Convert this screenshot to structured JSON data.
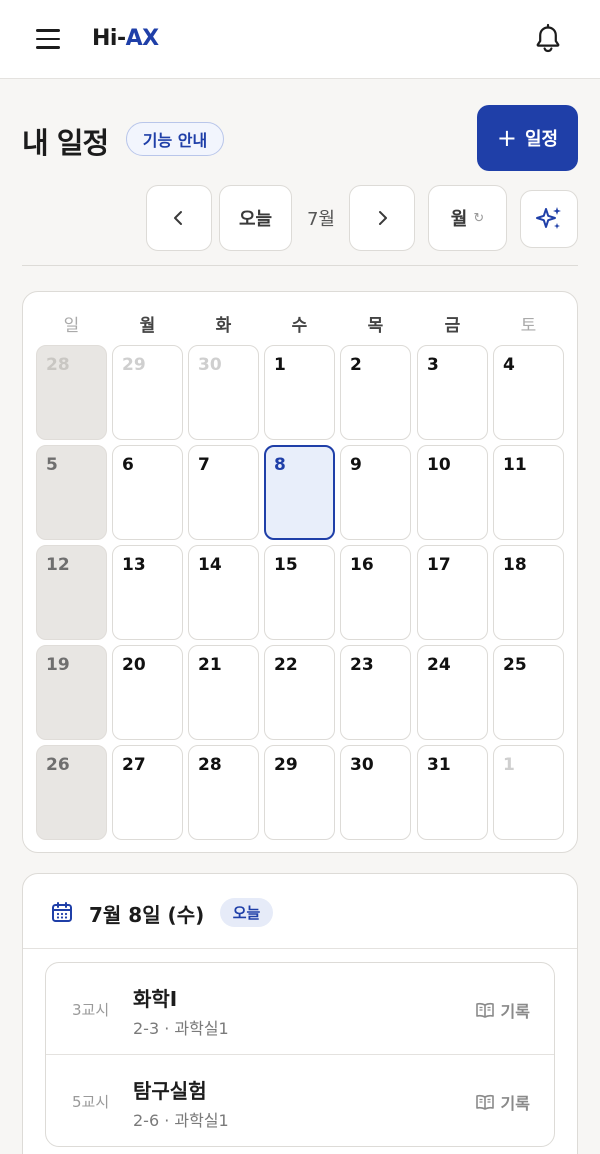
{
  "app": {
    "logo_prefix": "Hi-",
    "logo_suffix": "AX"
  },
  "header": {
    "title": "내 일정",
    "guide_label": "기능 안내",
    "add_label": "일정",
    "add_icon": "plus-icon"
  },
  "nav": {
    "today_label": "오늘",
    "month_label": "7월",
    "view_label": "월",
    "view_icon": "↻"
  },
  "calendar": {
    "weekdays": [
      "일",
      "월",
      "화",
      "수",
      "목",
      "금",
      "토"
    ],
    "weeks": [
      [
        "28",
        "29",
        "30",
        "1",
        "2",
        "3",
        "4"
      ],
      [
        "5",
        "6",
        "7",
        "8",
        "9",
        "10",
        "11"
      ],
      [
        "12",
        "13",
        "14",
        "15",
        "16",
        "17",
        "18"
      ],
      [
        "19",
        "20",
        "21",
        "22",
        "23",
        "24",
        "25"
      ],
      [
        "26",
        "27",
        "28",
        "29",
        "30",
        "31",
        "1"
      ]
    ],
    "today": "8"
  },
  "schedule": {
    "date": "7월 8일 (수)",
    "badge": "오늘",
    "items": [
      {
        "period": "3교시",
        "subject": "화학Ⅰ",
        "place": "2-3 · 과학실1",
        "action": "기록"
      },
      {
        "period": "5교시",
        "subject": "탐구실험",
        "place": "2-6 · 과학실1",
        "action": "기록"
      }
    ]
  },
  "colors": {
    "accent": "#1f3fa8",
    "background": "#f7f6f4",
    "sunday_cell": "#e8e6e3",
    "today_cell": "#e8eefa"
  }
}
